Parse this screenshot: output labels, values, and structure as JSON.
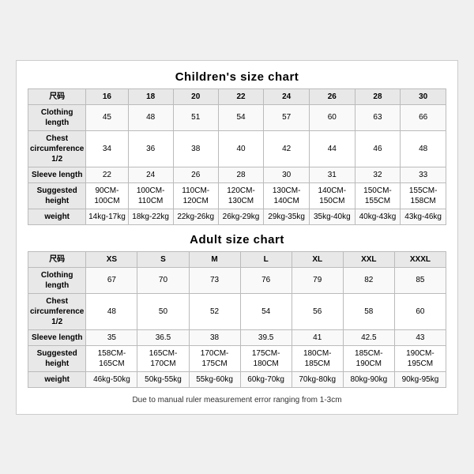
{
  "children_chart": {
    "title": "Children's size chart",
    "headers": [
      "尺码",
      "16",
      "18",
      "20",
      "22",
      "24",
      "26",
      "28",
      "30"
    ],
    "rows": [
      {
        "label": "Clothing length",
        "values": [
          "45",
          "48",
          "51",
          "54",
          "57",
          "60",
          "63",
          "66"
        ]
      },
      {
        "label": "Chest circumference 1/2",
        "values": [
          "34",
          "36",
          "38",
          "40",
          "42",
          "44",
          "46",
          "48"
        ]
      },
      {
        "label": "Sleeve length",
        "values": [
          "22",
          "24",
          "26",
          "28",
          "30",
          "31",
          "32",
          "33"
        ]
      },
      {
        "label": "Suggested height",
        "values": [
          "90CM-100CM",
          "100CM-110CM",
          "110CM-120CM",
          "120CM-130CM",
          "130CM-140CM",
          "140CM-150CM",
          "150CM-155CM",
          "155CM-158CM"
        ]
      },
      {
        "label": "weight",
        "values": [
          "14kg-17kg",
          "18kg-22kg",
          "22kg-26kg",
          "26kg-29kg",
          "29kg-35kg",
          "35kg-40kg",
          "40kg-43kg",
          "43kg-46kg"
        ]
      }
    ]
  },
  "adult_chart": {
    "title": "Adult size chart",
    "headers": [
      "尺码",
      "XS",
      "S",
      "M",
      "L",
      "XL",
      "XXL",
      "XXXL"
    ],
    "rows": [
      {
        "label": "Clothing length",
        "values": [
          "67",
          "70",
          "73",
          "76",
          "79",
          "82",
          "85"
        ]
      },
      {
        "label": "Chest circumference 1/2",
        "values": [
          "48",
          "50",
          "52",
          "54",
          "56",
          "58",
          "60"
        ]
      },
      {
        "label": "Sleeve length",
        "values": [
          "35",
          "36.5",
          "38",
          "39.5",
          "41",
          "42.5",
          "43"
        ]
      },
      {
        "label": "Suggested height",
        "values": [
          "158CM-165CM",
          "165CM-170CM",
          "170CM-175CM",
          "175CM-180CM",
          "180CM-185CM",
          "185CM-190CM",
          "190CM-195CM"
        ]
      },
      {
        "label": "weight",
        "values": [
          "46kg-50kg",
          "50kg-55kg",
          "55kg-60kg",
          "60kg-70kg",
          "70kg-80kg",
          "80kg-90kg",
          "90kg-95kg"
        ]
      }
    ]
  },
  "footer": "Due to manual ruler measurement error ranging from 1-3cm"
}
